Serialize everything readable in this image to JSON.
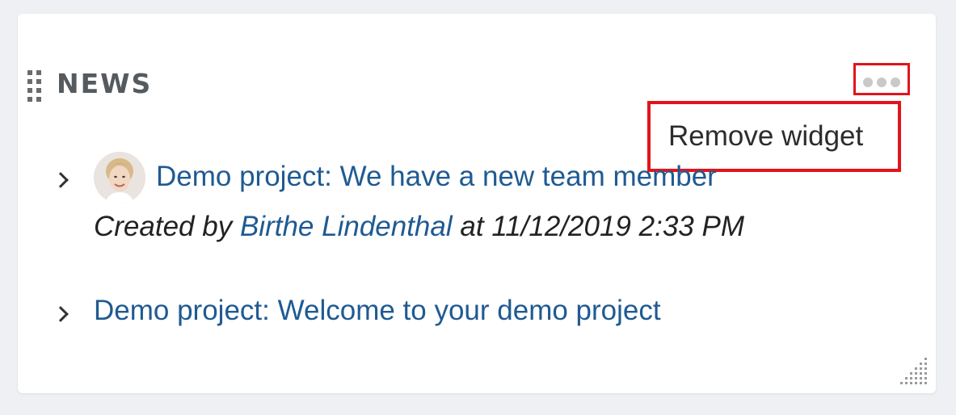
{
  "widget": {
    "title": "NEWS",
    "menu": {
      "icon": "ellipsis-icon",
      "items": [
        {
          "label": "Remove widget"
        }
      ]
    },
    "news": [
      {
        "link": "Demo project: We have a new team member",
        "avatar": "user-avatar",
        "meta": {
          "prefix": "Created by",
          "author": "Birthe Lindenthal",
          "separator": "at",
          "timestamp": "11/12/2019 2:33 PM"
        }
      },
      {
        "link": "Demo project: Welcome to your demo project"
      }
    ]
  },
  "colors": {
    "link": "#1f5a92",
    "highlight": "#e2141b",
    "title": "#555a5f"
  }
}
